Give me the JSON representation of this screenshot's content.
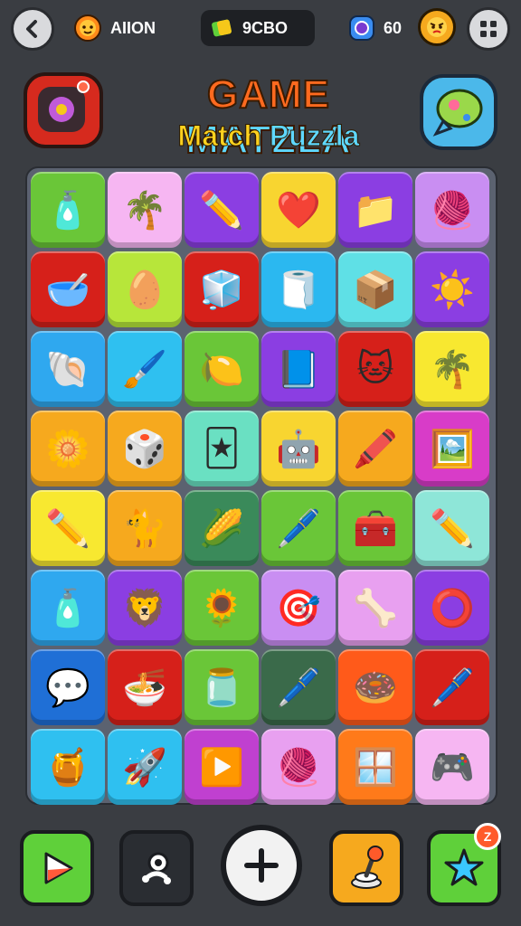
{
  "header": {
    "player_label": "AIION",
    "score_label": "9CBO",
    "gems_count": "60",
    "back_icon": "chevron-left-icon",
    "menu_icon": "grid-icon",
    "player_icon": "sun-face-icon",
    "score_icon": "gem-icon",
    "gems_icon": "gem-ring-icon",
    "avatar_icon": "angry-face-icon"
  },
  "title": {
    "line1_a": "GAME",
    "line1_b": "MATZLA",
    "line2_a": "Match",
    "line2_b": "Puzzla"
  },
  "board": {
    "tiles": [
      {
        "color": "#6ac638",
        "icon": "glue-stick"
      },
      {
        "color": "#f6b6f2",
        "icon": "palm-tree"
      },
      {
        "color": "#8b3ee2",
        "icon": "pencil"
      },
      {
        "color": "#f8d530",
        "icon": "heart-blob"
      },
      {
        "color": "#8b3ee2",
        "icon": "folder"
      },
      {
        "color": "#c98ef2",
        "icon": "yarn-ball"
      },
      {
        "color": "#d6201a",
        "icon": "bowl"
      },
      {
        "color": "#b7e63a",
        "icon": "egg-face"
      },
      {
        "color": "#d6201a",
        "icon": "cube"
      },
      {
        "color": "#2bb8f0",
        "icon": "tape-dispenser"
      },
      {
        "color": "#5fe0e6",
        "icon": "box"
      },
      {
        "color": "#8b3ee2",
        "icon": "sun"
      },
      {
        "color": "#2fa8ef",
        "icon": "shell"
      },
      {
        "color": "#2fc0f0",
        "icon": "brush"
      },
      {
        "color": "#6ac638",
        "icon": "lemon"
      },
      {
        "color": "#8b3ee2",
        "icon": "book"
      },
      {
        "color": "#d6201a",
        "icon": "cat-blob"
      },
      {
        "color": "#f8e830",
        "icon": "palm-tree"
      },
      {
        "color": "#f6a91e",
        "icon": "flower-ring"
      },
      {
        "color": "#f6a91e",
        "icon": "dice-box"
      },
      {
        "color": "#6ae0c2",
        "icon": "card-stack"
      },
      {
        "color": "#f8d530",
        "icon": "robot-box"
      },
      {
        "color": "#f6a91e",
        "icon": "crayon"
      },
      {
        "color": "#d83cc8",
        "icon": "pencil-frame"
      },
      {
        "color": "#f8e830",
        "icon": "pencil"
      },
      {
        "color": "#f6a91e",
        "icon": "cat-face"
      },
      {
        "color": "#3a8a5a",
        "icon": "corn"
      },
      {
        "color": "#6ac638",
        "icon": "marker"
      },
      {
        "color": "#6ac638",
        "icon": "toaster"
      },
      {
        "color": "#8ee6d8",
        "icon": "pencil"
      },
      {
        "color": "#2fa8ef",
        "icon": "glue-stick"
      },
      {
        "color": "#8b3ee2",
        "icon": "lion-face"
      },
      {
        "color": "#6ac638",
        "icon": "sun-flower"
      },
      {
        "color": "#c98ef2",
        "icon": "arrow-frame"
      },
      {
        "color": "#e8a0f0",
        "icon": "bone"
      },
      {
        "color": "#8b3ee2",
        "icon": "ring"
      },
      {
        "color": "#1f6fd6",
        "icon": "speech-blob"
      },
      {
        "color": "#d6201a",
        "icon": "bowl-face"
      },
      {
        "color": "#6ac638",
        "icon": "jar"
      },
      {
        "color": "#3a6a4a",
        "icon": "marker"
      },
      {
        "color": "#ff5a1a",
        "icon": "donut"
      },
      {
        "color": "#d6201a",
        "icon": "marker"
      },
      {
        "color": "#2fc0f0",
        "icon": "jam-jar"
      },
      {
        "color": "#2fc0f0",
        "icon": "rocket"
      },
      {
        "color": "#c040d0",
        "icon": "play-tag"
      },
      {
        "color": "#e8a0f0",
        "icon": "yarn-ball"
      },
      {
        "color": "#ff7a1a",
        "icon": "window-pencil"
      },
      {
        "color": "#f6b6f2",
        "icon": "console"
      }
    ]
  },
  "bottom": {
    "play_icon": "play-icon",
    "robot_icon": "robot-icon",
    "add_icon": "plus-icon",
    "joystick_icon": "joystick-icon",
    "star_icon": "star-icon",
    "star_badge": "Z",
    "colors": {
      "play": "#5fd03a",
      "robot": "#2a2d32",
      "joystick": "#f6a91e",
      "star": "#5fd03a"
    }
  }
}
